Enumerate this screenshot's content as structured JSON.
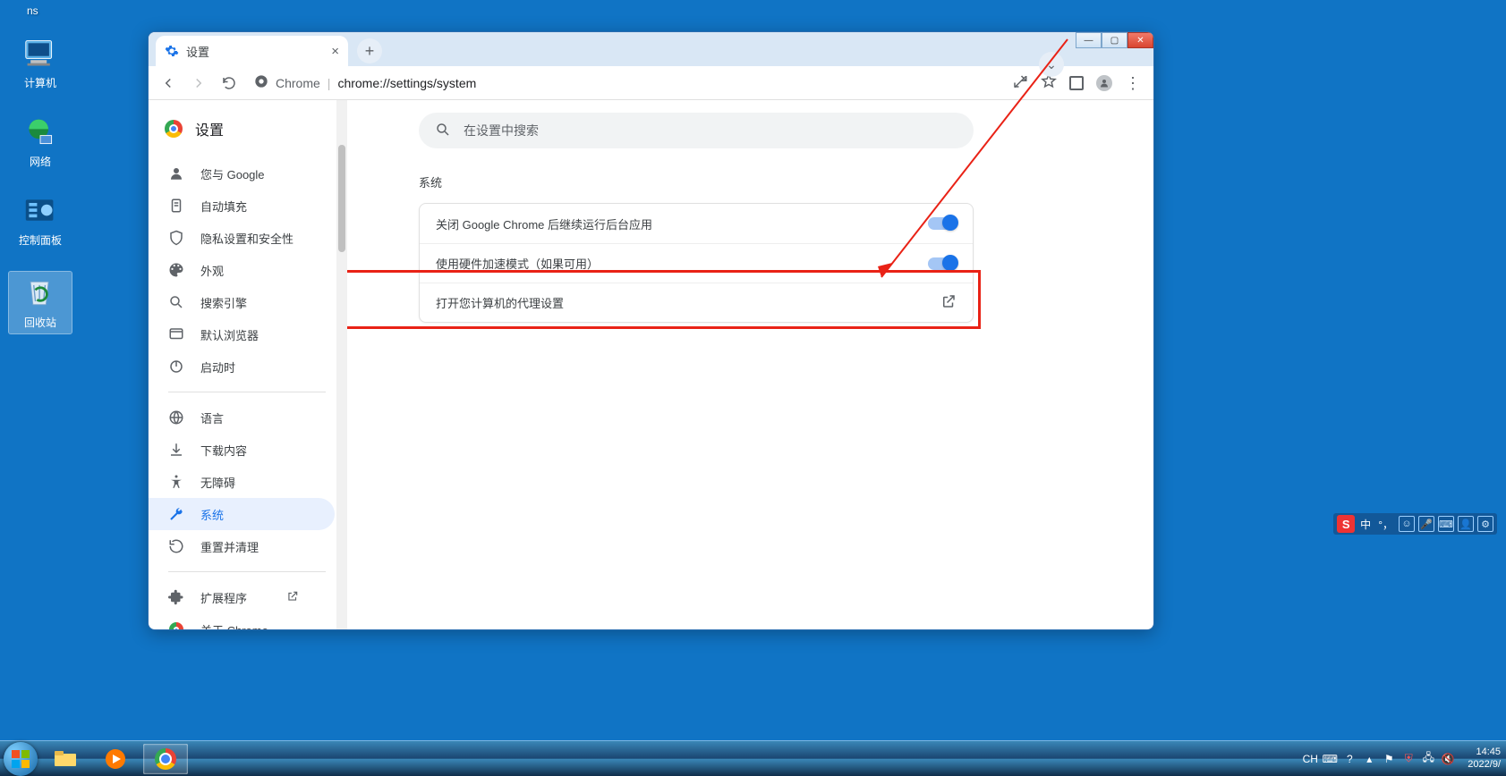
{
  "ns_label": "ns",
  "desktop": {
    "computer": "计算机",
    "network": "网络",
    "control_panel": "控制面板",
    "recycle_bin": "回收站"
  },
  "browser": {
    "tab_title": "设置",
    "address_prefix": "Chrome",
    "address_url": "chrome://settings/system"
  },
  "settings": {
    "title": "设置",
    "search_placeholder": "在设置中搜索",
    "nav": {
      "you_and_google": "您与 Google",
      "autofill": "自动填充",
      "privacy": "隐私设置和安全性",
      "appearance": "外观",
      "search_engine": "搜索引擎",
      "default_browser": "默认浏览器",
      "on_startup": "启动时",
      "languages": "语言",
      "downloads": "下载内容",
      "accessibility": "无障碍",
      "system": "系统",
      "reset": "重置并清理",
      "extensions": "扩展程序",
      "about": "关于 Chrome"
    },
    "section_title": "系统",
    "rows": {
      "bg_apps": "关闭 Google Chrome 后继续运行后台应用",
      "hw_accel": "使用硬件加速模式（如果可用）",
      "proxy": "打开您计算机的代理设置"
    }
  },
  "ime": {
    "badge": "S",
    "lang": "中",
    "punct": "°，"
  },
  "taskbar": {
    "lang": "CH",
    "time": "14:45",
    "date": "2022/9/"
  }
}
